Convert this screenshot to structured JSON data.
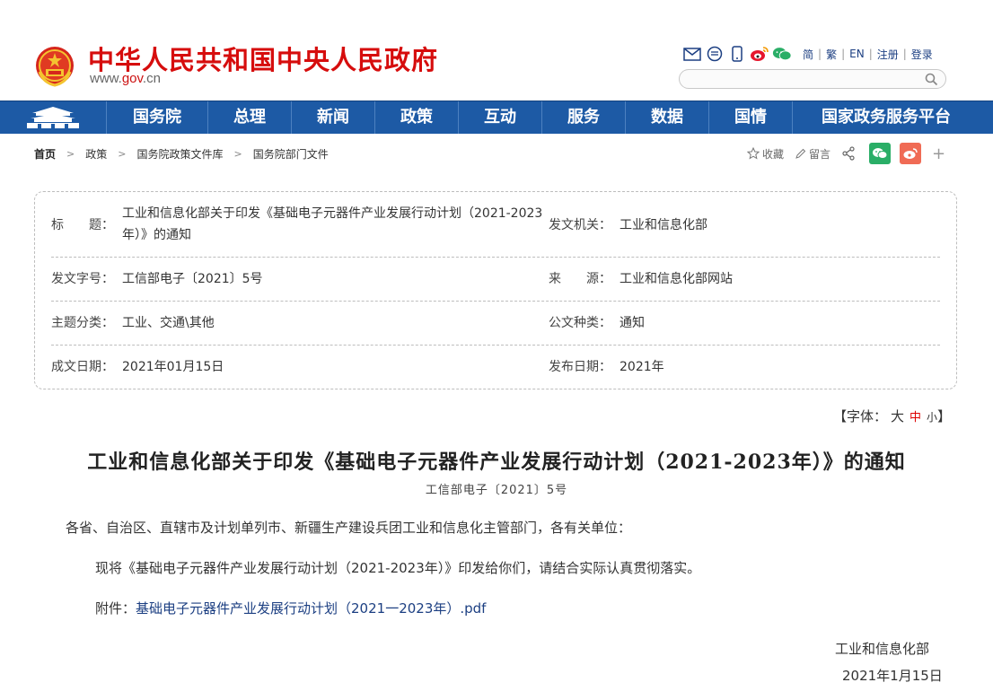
{
  "header": {
    "site_title": "中华人民共和国中央人民政府",
    "domain_prefix": "www.",
    "domain_main": "gov",
    "domain_suffix": ".cn",
    "share_icons": [
      "mail-icon",
      "message-icon",
      "mobile-icon",
      "weibo-icon",
      "wechat-icon"
    ],
    "links": [
      "简",
      "繁",
      "EN",
      "注册",
      "登录"
    ],
    "search_placeholder": ""
  },
  "nav": {
    "items": [
      "国务院",
      "总理",
      "新闻",
      "政策",
      "互动",
      "服务",
      "数据",
      "国情",
      "国家政务服务平台"
    ],
    "color": "#1d5aa5"
  },
  "breadcrumb": [
    "首页",
    "政策",
    "国务院政策文件库",
    "国务院部门文件"
  ],
  "tools": {
    "favorite": "收藏",
    "comment": "留言",
    "plus": "+"
  },
  "info": {
    "title_label": "标　　题：",
    "title_value_line1": "工业和信息化部关于印发《基础电子元器件产业发展行动计划（2021-2023",
    "title_value_line2": "年）》的通知",
    "issuer_label": "发文机关：",
    "issuer_value": "工业和信息化部",
    "docno_label": "发文字号：",
    "docno_value": "工信部电子〔2021〕5号",
    "source_label": "来　　源：",
    "source_value": "工业和信息化部网站",
    "topic_label": "主题分类：",
    "topic_value": "工业、交通\\其他",
    "type_label": "公文种类：",
    "type_value": "通知",
    "written_label": "成文日期：",
    "written_value": "2021年01月15日",
    "published_label": "发布日期：",
    "published_value": "2021年"
  },
  "fontsize": {
    "prefix": "【字体：",
    "large": "大",
    "medium": "中",
    "small": "小",
    "suffix": "】"
  },
  "article": {
    "title": "工业和信息化部关于印发《基础电子元器件产业发展行动计划（2021-2023年）》的通知",
    "doc_no": "工信部电子〔2021〕5号",
    "salutation": "各省、自治区、直辖市及计划单列市、新疆生产建设兵团工业和信息化主管部门，各有关单位：",
    "body": "现将《基础电子元器件产业发展行动计划（2021-2023年）》印发给你们，请结合实际认真贯彻落实。",
    "attachment_label": "附件：",
    "attachment_link": "基础电子元器件产业发展行动计划（2021一2023年）.pdf",
    "signature": "工业和信息化部",
    "date": "2021年1月15日"
  }
}
